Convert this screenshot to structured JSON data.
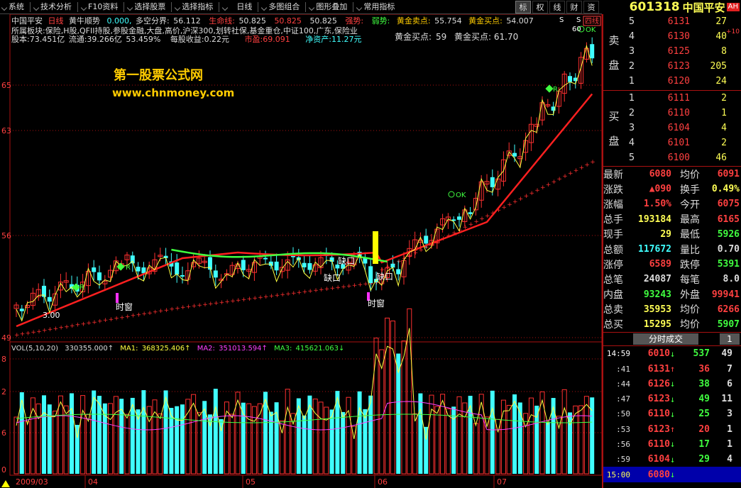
{
  "toolbar": {
    "items": [
      "技术分析",
      "F10资料",
      "选择股票",
      "选择指标",
      "日线",
      "多图组合",
      "图形叠加",
      "常用指标"
    ],
    "right_buttons": [
      "标",
      "权",
      "线",
      "财",
      "资"
    ],
    "system_menu": "系统"
  },
  "stock": {
    "code": "601318",
    "name": "中国平安",
    "ah": "AH"
  },
  "chart": {
    "title_line": {
      "name": "中国平安",
      "period": "日线",
      "indicator": "黄牛顺势",
      "v0": "0.000,",
      "duokong_label": "多空分界:",
      "duokong_val": "56.112",
      "life_label": "生命线:",
      "life_val": "50.825",
      "v3": "50.825",
      "v4": "50.825",
      "strong": "强势:",
      "weak": "弱势:",
      "sell_label": "黄金卖点:",
      "sell_val": "55.754",
      "buy_label": "黄金买点:",
      "buy_val": "54.007",
      "tag_4line": "四线"
    },
    "info_line1": "所属板块:保险,H股,QFII持股,参股金融,大盘,高价,沪深300,划转社保,基金重仓,中证100,广东,保险业",
    "info_line2": {
      "capital": "股本:73.451亿",
      "float": "流通:39.266亿",
      "pct": "53.459%",
      "eps": "每股收益:0.22元",
      "pe": "市盈:69.091",
      "net": "净资产:11.27元"
    },
    "buy_point_left": "黄金买点:",
    "buy_point_left_num": "59",
    "buy_point_right": "黄金买点: 61.70",
    "watermark_cn": "第一股票公式网",
    "watermark_url": "www.chnmoney.com",
    "y_labels_left": [
      "65",
      "63",
      "56",
      "49"
    ],
    "label_low": "3.00",
    "label_shichuang1": "时窗",
    "label_shichuang2": "时窗",
    "label_quekou1": "缺口",
    "label_quekou2": "缺口",
    "label_quekou3": "缺口",
    "label_ok1": "OK",
    "label_ok2": "OK",
    "label_r": "R",
    "label_60": "60",
    "label_s1": "S",
    "label_s2": "S"
  },
  "volume": {
    "title": "VOL(5,10,20)",
    "vol": "330355.000↑",
    "ma1_label": "MA1:",
    "ma1": "368325.406↑",
    "ma2_label": "MA2:",
    "ma2": "351013.594↑",
    "ma3_label": "MA3:",
    "ma3": "415621.063↓",
    "y_labels": [
      "8",
      "2",
      "6",
      "0"
    ]
  },
  "x_axis": [
    "2009/03",
    "04",
    "05",
    "06",
    "07"
  ],
  "orderbook": {
    "sell_label_1": "卖",
    "sell_label_2": "盘",
    "buy_label_1": "买",
    "buy_label_2": "盘",
    "sell": [
      {
        "idx": "5",
        "price": "6131",
        "vol": "27"
      },
      {
        "idx": "4",
        "price": "6130",
        "vol": "40"
      },
      {
        "idx": "3",
        "price": "6125",
        "vol": "8"
      },
      {
        "idx": "2",
        "price": "6123",
        "vol": "205"
      },
      {
        "idx": "1",
        "price": "6120",
        "vol": "24"
      }
    ],
    "buy": [
      {
        "idx": "1",
        "price": "6111",
        "vol": "2"
      },
      {
        "idx": "2",
        "price": "6110",
        "vol": "1"
      },
      {
        "idx": "3",
        "price": "6104",
        "vol": "4"
      },
      {
        "idx": "4",
        "price": "6101",
        "vol": "2"
      },
      {
        "idx": "5",
        "price": "6100",
        "vol": "46"
      }
    ],
    "extra": "+10"
  },
  "stats": [
    {
      "l1": "最新",
      "v1": "6080",
      "c1": "red",
      "l2": "均价",
      "v2": "6091",
      "c2": "red"
    },
    {
      "l1": "涨跌",
      "v1": "▲090",
      "c1": "red",
      "l2": "换手",
      "v2": "0.49%",
      "c2": "yellow"
    },
    {
      "l1": "涨幅",
      "v1": "1.50%",
      "c1": "red",
      "l2": "今开",
      "v2": "6075",
      "c2": "red"
    },
    {
      "l1": "总手",
      "v1": "193184",
      "c1": "yellow",
      "l2": "最高",
      "v2": "6165",
      "c2": "red"
    },
    {
      "l1": "现手",
      "v1": "29",
      "c1": "yellow",
      "l2": "最低",
      "v2": "5926",
      "c2": "green"
    },
    {
      "l1": "总额",
      "v1": "117672",
      "c1": "cyan",
      "l2": "量比",
      "v2": "0.70",
      "c2": "white"
    },
    {
      "l1": "涨停",
      "v1": "6589",
      "c1": "red",
      "l2": "跌停",
      "v2": "5391",
      "c2": "green"
    },
    {
      "l1": "总笔",
      "v1": "24087",
      "c1": "white",
      "l2": "每笔",
      "v2": "8.0",
      "c2": "white"
    },
    {
      "l1": "内盘",
      "v1": "93243",
      "c1": "green",
      "l2": "外盘",
      "v2": "99941",
      "c2": "red"
    },
    {
      "l1": "总卖",
      "v1": "35953",
      "c1": "yellow",
      "l2": "均价",
      "v2": "6266",
      "c2": "red"
    },
    {
      "l1": "总买",
      "v1": "15295",
      "c1": "yellow",
      "l2": "均价",
      "v2": "5907",
      "c2": "green"
    }
  ],
  "ticks_tab": "分时成交",
  "ticks_tab2": "1",
  "ticks": [
    {
      "time": "14:59",
      "price": "6010",
      "arrow": "↓",
      "vol": "537",
      "cnt": "49",
      "pc": "red",
      "ac": "green",
      "vc": "green"
    },
    {
      "time": ":41",
      "price": "6131",
      "arrow": "↑",
      "vol": "36",
      "cnt": "7",
      "pc": "red",
      "ac": "red",
      "vc": "red"
    },
    {
      "time": ":44",
      "price": "6126",
      "arrow": "↓",
      "vol": "38",
      "cnt": "6",
      "pc": "red",
      "ac": "green",
      "vc": "green"
    },
    {
      "time": ":47",
      "price": "6123",
      "arrow": "↓",
      "vol": "49",
      "cnt": "11",
      "pc": "red",
      "ac": "green",
      "vc": "green"
    },
    {
      "time": ":50",
      "price": "6110",
      "arrow": "↓",
      "vol": "25",
      "cnt": "3",
      "pc": "red",
      "ac": "green",
      "vc": "green"
    },
    {
      "time": ":53",
      "price": "6123",
      "arrow": "↑",
      "vol": "20",
      "cnt": "1",
      "pc": "red",
      "ac": "red",
      "vc": "red"
    },
    {
      "time": ":56",
      "price": "6110",
      "arrow": "↓",
      "vol": "17",
      "cnt": "1",
      "pc": "red",
      "ac": "green",
      "vc": "green"
    },
    {
      "time": ":59",
      "price": "6104",
      "arrow": "↓",
      "vol": "29",
      "cnt": "4",
      "pc": "red",
      "ac": "green",
      "vc": "green"
    },
    {
      "time": "15:00",
      "price": "6080",
      "arrow": "↓",
      "vol": "",
      "cnt": "",
      "pc": "red",
      "ac": "green",
      "vc": "green"
    }
  ]
}
